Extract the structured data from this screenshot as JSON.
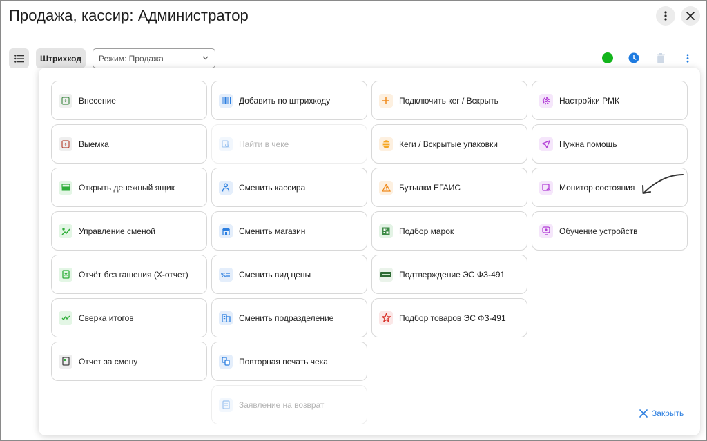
{
  "window": {
    "title": "Продажа, кассир: Администратор"
  },
  "toolbar": {
    "barcode_label": "Штрихкод",
    "mode_value": "Режим: Продажа"
  },
  "menu": {
    "col1": [
      {
        "label": "Внесение",
        "icon": "cash-in-icon"
      },
      {
        "label": "Выемка",
        "icon": "cash-out-icon"
      },
      {
        "label": "Открыть денежный ящик",
        "icon": "cash-drawer-icon"
      },
      {
        "label": "Управление сменой",
        "icon": "shift-icon"
      },
      {
        "label": "Отчёт без гашения (X-отчет)",
        "icon": "x-report-icon"
      },
      {
        "label": "Сверка итогов",
        "icon": "reconciliation-icon"
      },
      {
        "label": "Отчет за смену",
        "icon": "shift-report-icon"
      }
    ],
    "col2": [
      {
        "label": "Добавить по штрихкоду",
        "icon": "barcode-icon"
      },
      {
        "label": "Найти в чеке",
        "icon": "search-receipt-icon",
        "disabled": true
      },
      {
        "label": "Сменить кассира",
        "icon": "cashier-icon"
      },
      {
        "label": "Сменить магазин",
        "icon": "store-icon"
      },
      {
        "label": "Сменить вид цены",
        "icon": "price-type-icon"
      },
      {
        "label": "Сменить подразделение",
        "icon": "department-icon"
      },
      {
        "label": "Повторная печать чека",
        "icon": "reprint-icon"
      },
      {
        "label": "Заявление на возврат",
        "icon": "return-icon",
        "disabled": true
      }
    ],
    "col3": [
      {
        "label": "Подключить кег / Вскрыть",
        "icon": "plus-icon"
      },
      {
        "label": "Кеги / Вскрытые упаковки",
        "icon": "keg-icon"
      },
      {
        "label": "Бутылки ЕГАИС",
        "icon": "warning-icon"
      },
      {
        "label": "Подбор марок",
        "icon": "marks-icon"
      },
      {
        "label": "Подтверждение ЭС ФЗ-491",
        "icon": "mark-badge-icon"
      },
      {
        "label": "Подбор товаров ЭС ФЗ-491",
        "icon": "star-icon"
      }
    ],
    "col4": [
      {
        "label": "Настройки РМК",
        "icon": "settings-icon"
      },
      {
        "label": "Нужна помощь",
        "icon": "send-icon"
      },
      {
        "label": "Монитор состояния",
        "icon": "monitor-icon"
      },
      {
        "label": "Обучение устройств",
        "icon": "training-icon"
      }
    ]
  },
  "footer": {
    "close_label": "Закрыть"
  },
  "colors": {
    "accent": "#2c7fe0",
    "status_green": "#13b51c",
    "clock_blue": "#1e7be0"
  }
}
